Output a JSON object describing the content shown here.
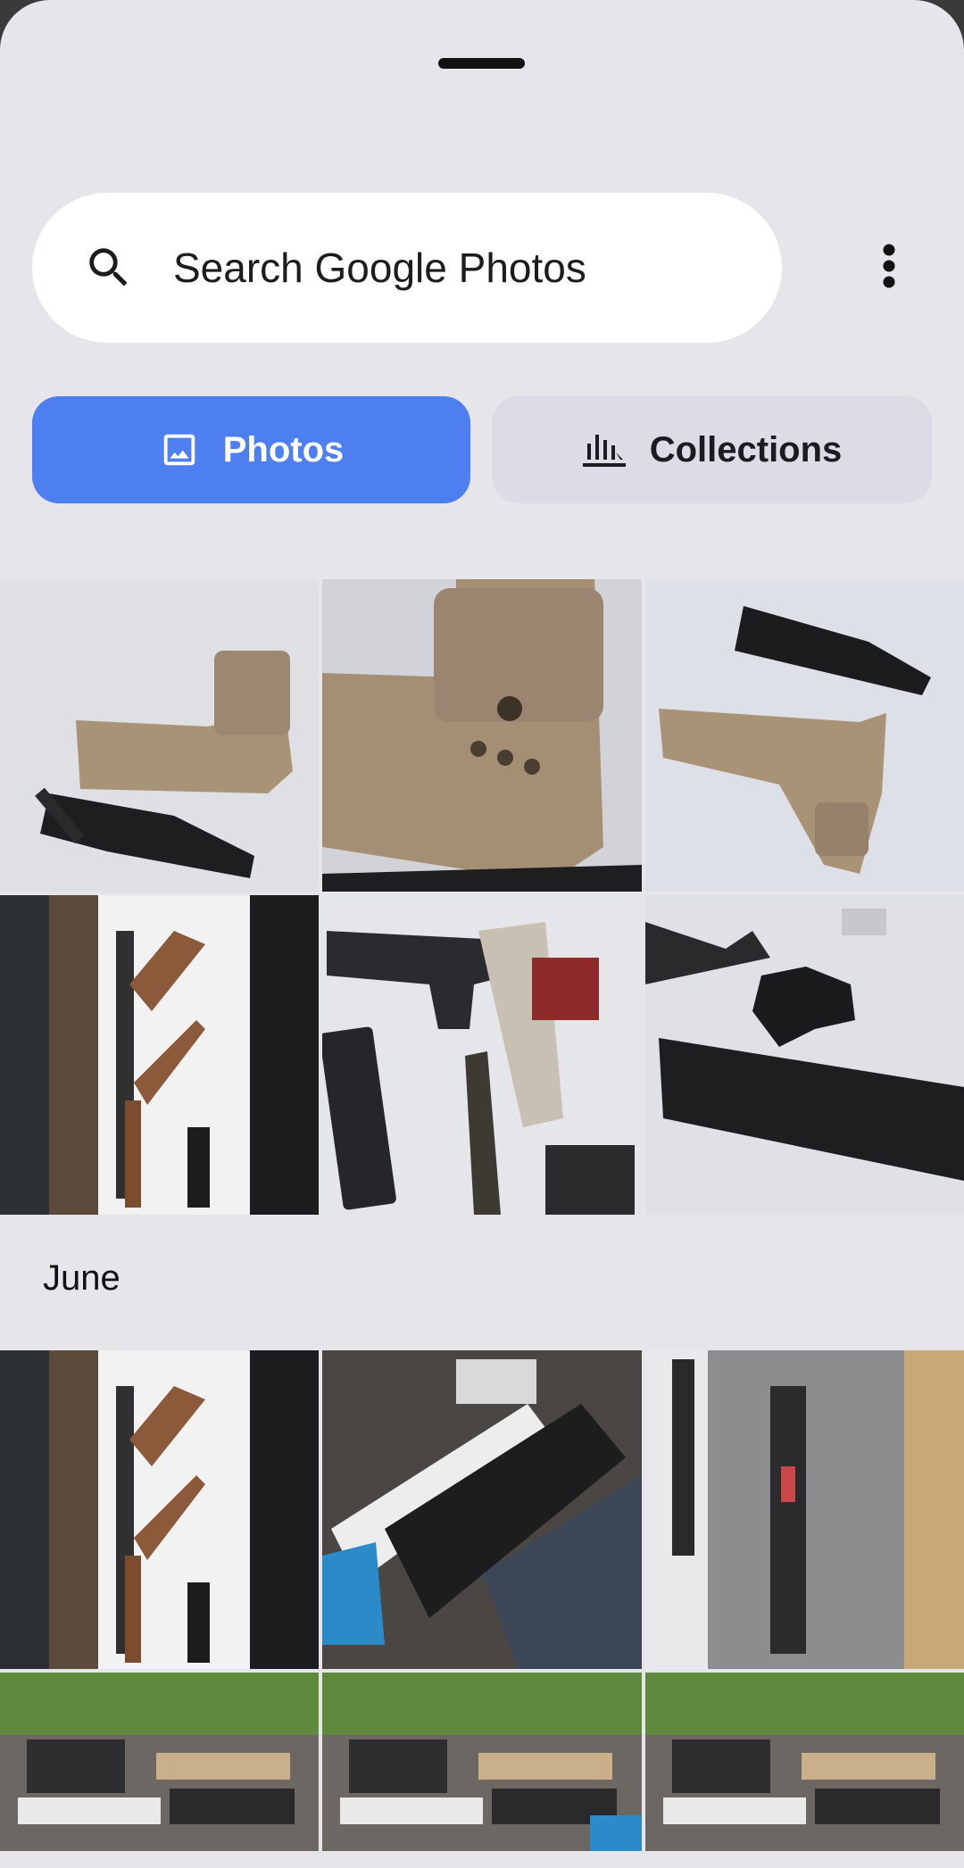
{
  "search": {
    "placeholder": "Search Google Photos",
    "icon": "search-icon"
  },
  "menu": {
    "icon": "more-vert-icon"
  },
  "tabs": [
    {
      "label": "Photos",
      "icon": "image-icon",
      "selected": true
    },
    {
      "label": "Collections",
      "icon": "library-icon",
      "selected": false
    }
  ],
  "sections": [
    {
      "label": "",
      "photo_count": 6
    },
    {
      "label": "June",
      "photo_count": 6
    }
  ],
  "colors": {
    "accent": "#4d7ff0",
    "background": "#e6e5ea",
    "tab_inactive": "#dcdbe6"
  }
}
